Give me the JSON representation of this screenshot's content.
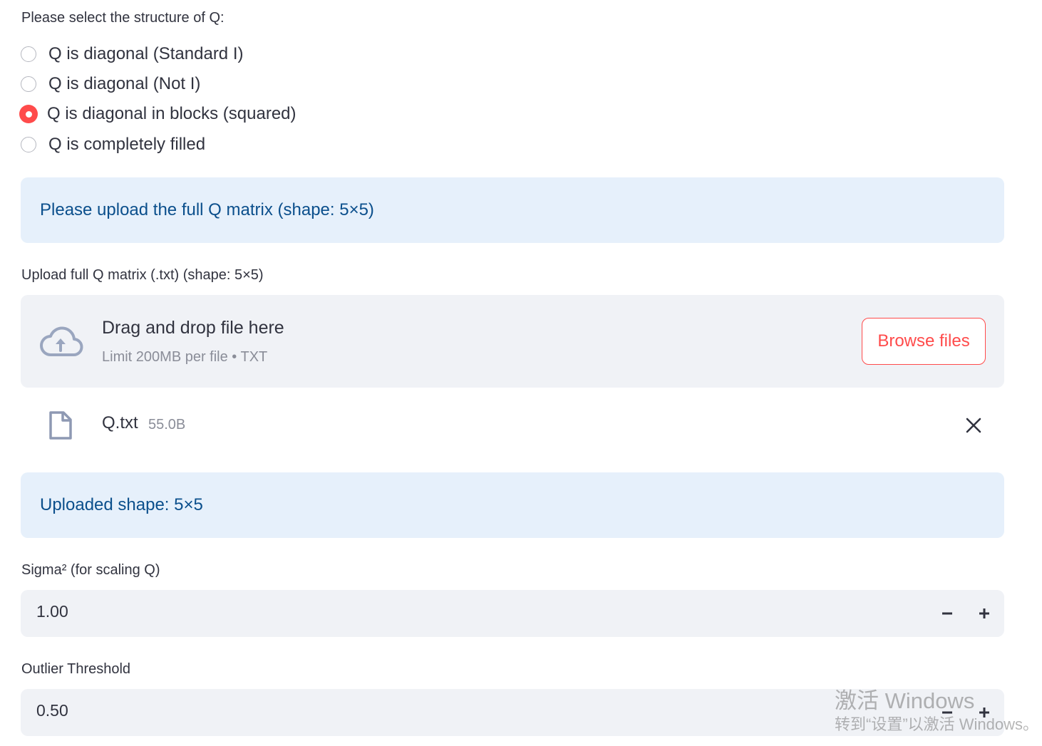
{
  "structure": {
    "label": "Please select the structure of Q:",
    "options": [
      {
        "label": "Q is diagonal (Standard I)",
        "selected": false
      },
      {
        "label": "Q is diagonal (Not I)",
        "selected": false
      },
      {
        "label": "Q is diagonal in blocks (squared)",
        "selected": true
      },
      {
        "label": "Q is completely filled",
        "selected": false
      }
    ]
  },
  "info_upload": "Please upload the full Q matrix (shape: 5×5)",
  "uploader": {
    "label": "Upload full Q matrix (.txt) (shape: 5×5)",
    "drop_title": "Drag and drop file here",
    "drop_sub": "Limit 200MB per file • TXT",
    "browse_label": "Browse files",
    "icon": "cloud-upload-icon"
  },
  "file": {
    "name": "Q.txt",
    "size": "55.0B",
    "icon": "file-icon"
  },
  "info_shape": "Uploaded shape: 5×5",
  "sigma": {
    "label": "Sigma² (for scaling Q)",
    "value": "1.00"
  },
  "outlier": {
    "label": "Outlier Threshold",
    "value": "0.50"
  },
  "watermark": {
    "line1": "激活 Windows",
    "line2": "转到“设置”以激活 Windows。"
  },
  "colors": {
    "accent": "#ff4b4b",
    "info_bg": "#e6f0fb",
    "info_text": "#0b4f8c",
    "input_bg": "#f0f2f6"
  }
}
